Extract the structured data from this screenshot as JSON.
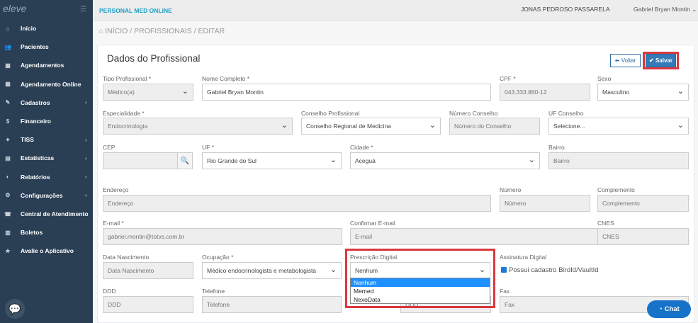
{
  "sidebar": {
    "logo": "eleve",
    "items": [
      {
        "label": "Início",
        "icon": "home-icon"
      },
      {
        "label": "Pacientes",
        "icon": "users-icon"
      },
      {
        "label": "Agendamentos",
        "icon": "calendar-icon"
      },
      {
        "label": "Agendamento Online",
        "icon": "calendar-icon"
      },
      {
        "label": "Cadastros",
        "icon": "edit-icon",
        "chevron": "‹"
      },
      {
        "label": "Financeiro",
        "icon": "dollar-icon"
      },
      {
        "label": "TISS",
        "icon": "tiss-icon",
        "chevron": "‹"
      },
      {
        "label": "Estatísticas",
        "icon": "chart-icon",
        "chevron": "‹"
      },
      {
        "label": "Relatórios",
        "icon": "report-icon",
        "chevron": "‹"
      },
      {
        "label": "Configurações",
        "icon": "gear-icon",
        "chevron": "‹"
      },
      {
        "label": "Central de Atendimento",
        "icon": "support-icon"
      },
      {
        "label": "Boletos",
        "icon": "barcode-icon"
      },
      {
        "label": "Avalie o Aplicativo",
        "icon": "star-icon"
      }
    ]
  },
  "topbar": {
    "brand": "PERSONAL MED ONLINE",
    "user": "JONAS PEDROSO PASSARELA",
    "account": "Gabriel Bryan Montin ⌄"
  },
  "breadcrumb": "INÍCIO / PROFISSIONAIS / EDITAR",
  "form": {
    "title": "Dados do Profissional",
    "back_label": "Voltar",
    "save_label": "Salvar",
    "labels": {
      "tipo": "Tipo Profissional *",
      "nome": "Nome Completo *",
      "cpf": "CPF *",
      "sexo": "Sexo",
      "especialidade": "Especialidade *",
      "conselho": "Conselho Profissional",
      "numero_conselho": "Número Conselho",
      "uf_conselho": "UF Conselho",
      "cep": "CEP",
      "uf": "UF *",
      "cidade": "Cidade *",
      "bairro": "Bairro",
      "endereco": "Endereço",
      "numero": "Número",
      "complemento": "Complemento",
      "email": "E-mail *",
      "confirmar": "Confirmar E-mail",
      "cnes": "CNES",
      "nascimento": "Data Nascimento",
      "ocupacao": "Ocupação *",
      "prescricao": "Prescrição Digital",
      "assinatura": "Assinatura Digital",
      "ddd": "DDD",
      "telefone": "Telefone",
      "fax": "Fax"
    },
    "values": {
      "tipo": "Médico(a)",
      "nome": "Gabriel Bryan Montin",
      "cpf": "043.333.860-12",
      "sexo": "Masculino",
      "especialidade": "Endocrinologia",
      "conselho": "Conselho Regional de Medicina",
      "numero_conselho": "Número do Conselho",
      "uf_conselho": "Selecione...",
      "cep": "",
      "uf": "Rio Grande do Sul",
      "cidade": "Aceguá",
      "bairro": "Bairro",
      "endereco": "Endereço",
      "numero": "Número",
      "complemento": "Complemento",
      "email": "gabriel.montin@totvs.com.br",
      "confirmar": "E-mail",
      "cnes": "CNES",
      "nascimento": "Data Nascimento",
      "ocupacao": "Médico endocrinologista e metabologista",
      "prescricao": "Nenhum",
      "ddd": "DDD",
      "telefone": "Telefone",
      "fax": "Fax",
      "hidden_ddd": "DDD"
    },
    "prescricao_options": [
      "Nenhum",
      "Memed",
      "NexoData"
    ],
    "assinatura_check": "Possui cadastro BirdId/VaultId"
  },
  "chat_label": "Chat",
  "colors": {
    "sidebar": "#2a3f54",
    "accent": "#337ab7",
    "highlight": "#d9383e"
  }
}
